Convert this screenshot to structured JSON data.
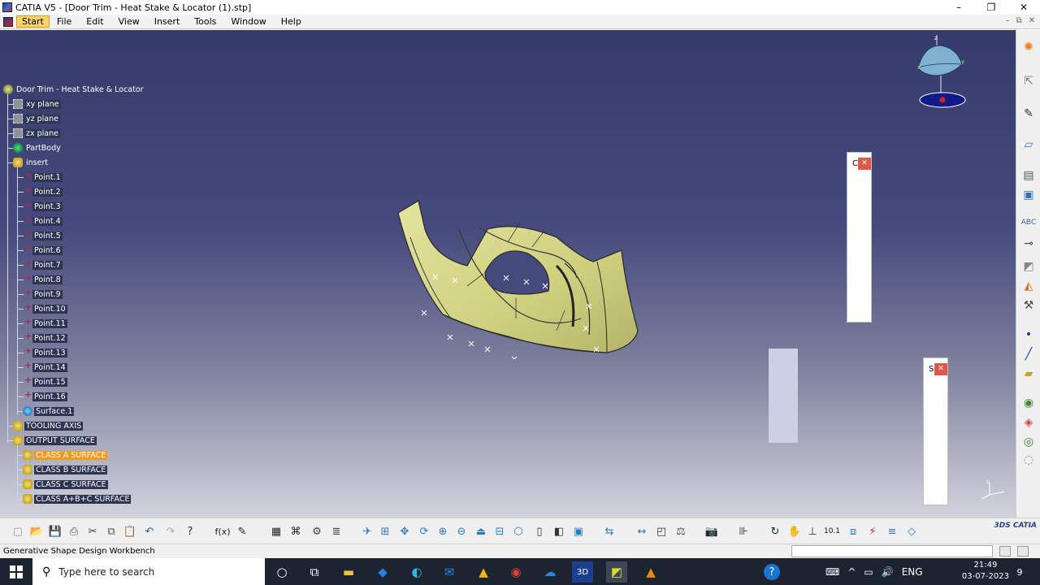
{
  "window": {
    "title": "CATIA V5 - [Door Trim - Heat Stake & Locator (1).stp]",
    "controls": [
      "–",
      "❐",
      "✕"
    ]
  },
  "menubar": {
    "items": [
      "Start",
      "File",
      "Edit",
      "View",
      "Insert",
      "Tools",
      "Window",
      "Help"
    ],
    "mdi_controls": [
      "–",
      "⧉",
      "✕"
    ]
  },
  "tree": {
    "root": "Door Trim - Heat Stake & Locator",
    "planes": [
      "xy plane",
      "yz plane",
      "zx plane"
    ],
    "partbody": "PartBody",
    "insert": "insert",
    "points": [
      "Point.1",
      "Point.2",
      "Point.3",
      "Point.4",
      "Point.5",
      "Point.6",
      "Point.7",
      "Point.8",
      "Point.9",
      "Point.10",
      "Point.11",
      "Point.12",
      "Point.13",
      "Point.14",
      "Point.15",
      "Point.16"
    ],
    "surface": "Surface.1",
    "tooling_axis": "TOOLING AXIS",
    "output_surface": "OUTPUT  SURFACE",
    "output_children": [
      "CLASS A SURFACE",
      "CLASS B SURFACE",
      "CLASS C SURFACE",
      "CLASS A+B+C  SURFACE"
    ],
    "selected_index": 0
  },
  "floating_windows": [
    {
      "letter": "C"
    },
    {
      "letter": "S"
    }
  ],
  "statusbar": {
    "text": "Generative Shape Design Workbench"
  },
  "taskbar": {
    "search_placeholder": "Type here to search",
    "language": "ENG",
    "time": "21:49",
    "date": "03-07-2023",
    "notification_count": "9"
  },
  "colors": {
    "viewport_top": "#363b6b",
    "viewport_bottom": "#d2d3dc",
    "part_fill": "#d7d88c",
    "selection": "#f39a1e",
    "tree_highlight": "#2e3553"
  }
}
